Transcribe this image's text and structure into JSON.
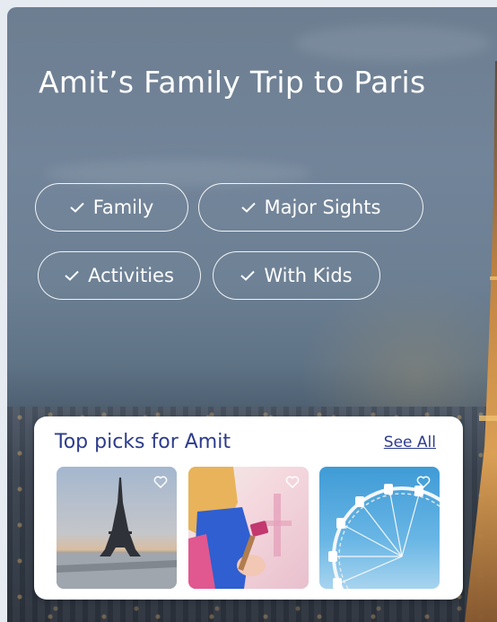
{
  "trip": {
    "title": "Amit’s Family Trip to Paris",
    "background_photo": "eiffel-tower-at-dusk"
  },
  "tags": [
    {
      "label": "Family",
      "icon": "check-icon",
      "selected": true
    },
    {
      "label": "Major Sights",
      "icon": "check-icon",
      "selected": true
    },
    {
      "label": "Activities",
      "icon": "check-icon",
      "selected": true
    },
    {
      "label": "With Kids",
      "icon": "check-icon",
      "selected": true
    }
  ],
  "top_picks": {
    "heading": "Top picks for Amit",
    "see_all_label": "See All",
    "items": [
      {
        "image": "eiffel-tower-photo",
        "icon": "heart-icon"
      },
      {
        "image": "child-painting-photo",
        "icon": "heart-icon"
      },
      {
        "image": "ferris-wheel-photo",
        "icon": "heart-icon"
      }
    ]
  },
  "colors": {
    "accent": "#2d3c8c",
    "chip_border": "#ffffff",
    "card_background": "#ffffff"
  }
}
